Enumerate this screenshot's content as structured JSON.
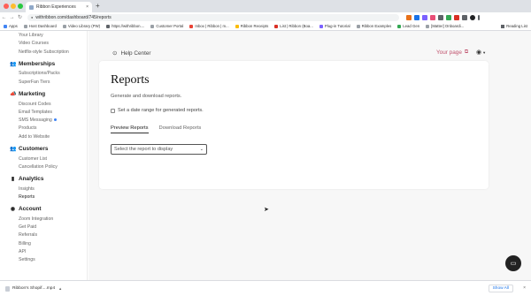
{
  "browser": {
    "tab_title": "Ribbon Experiences",
    "tab_close": "×",
    "new_tab": "+",
    "url": "withribbon.com/dashboard/745/reports",
    "back": "←",
    "forward": "→",
    "reload": "↻",
    "bookmarks": [
      {
        "label": "Apps",
        "color": "#4285f4"
      },
      {
        "label": "Host Dashboard",
        "color": "#9aa0a6"
      },
      {
        "label": "Video Library (PW)",
        "color": "#9aa0a6"
      },
      {
        "label": "https://withribbon....",
        "color": "#5f6368"
      },
      {
        "label": "Customer Portal",
        "color": "#9aa0a6"
      },
      {
        "label": "Inbox | Ribbon | m...",
        "color": "#ea4335"
      },
      {
        "label": "Ribbon Receipts",
        "color": "#fbbc04"
      },
      {
        "label": "List | Ribbon (Boa...",
        "color": "#d93025"
      },
      {
        "label": "Plug-in Tutorial",
        "color": "#7b61ff"
      },
      {
        "label": "Ribbon Examples",
        "color": "#9aa0a6"
      },
      {
        "label": "Lead Gen",
        "color": "#34a853"
      },
      {
        "label": "[Matter] Onboardi...",
        "color": "#9aa0a6"
      }
    ],
    "reading_list": "Reading List"
  },
  "sidebar": {
    "items_top": [
      "Your Library",
      "Video Courses",
      "Netflix-style Subscription"
    ],
    "sections": [
      {
        "heading": "Memberships",
        "icon": "people-icon",
        "glyph": "👥",
        "items": [
          "Subscriptions/Packs",
          "SuperFan Tiers"
        ]
      },
      {
        "heading": "Marketing",
        "icon": "megaphone-icon",
        "glyph": "📣",
        "items": [
          "Discount Codes",
          "Email Templates",
          "SMS Messaging",
          "Products",
          "Add to Website"
        ]
      },
      {
        "heading": "Customers",
        "icon": "users-icon",
        "glyph": "👥",
        "items": [
          "Customer List",
          "Cancellation Policy"
        ]
      },
      {
        "heading": "Analytics",
        "icon": "bar-chart-icon",
        "glyph": "▮",
        "items": [
          "Insights",
          "Reports"
        ]
      },
      {
        "heading": "Account",
        "icon": "account-circle-icon",
        "glyph": "◉",
        "items": [
          "Zoom Integration",
          "Get Paid",
          "Referrals",
          "Billing",
          "API",
          "Settings"
        ]
      }
    ]
  },
  "header": {
    "help_center": "Help Center",
    "your_page": "Your page"
  },
  "reports": {
    "title": "Reports",
    "subtitle": "Generate and download reports.",
    "date_range_label": "Set a date range for generated reports.",
    "tabs": [
      "Preview Reports",
      "Download Reports"
    ],
    "select_placeholder": "Select the report to display"
  },
  "downloads": {
    "file_name": "Ribbon's Shopif....mp4",
    "show_all": "Show All",
    "close": "×"
  },
  "colors": {
    "accent": "#c0536e",
    "sms_dot": "#3b82f6"
  }
}
